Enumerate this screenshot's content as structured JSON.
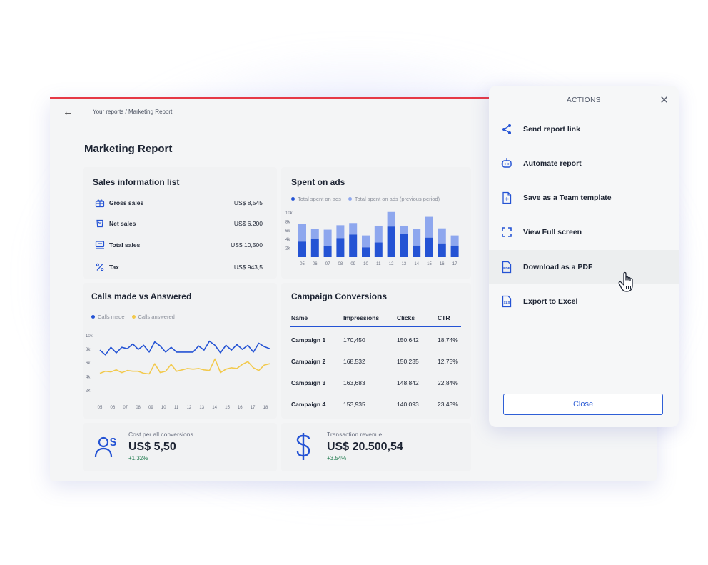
{
  "breadcrumb": "Your reports / Marketing Report",
  "page_title": "Marketing Report",
  "colors": {
    "primary": "#2453d4",
    "primary_light": "#8ea7ee",
    "yellow": "#f2c94c",
    "green": "#1f7a4d",
    "red_accent": "#e63946"
  },
  "sales": {
    "title": "Sales information list",
    "rows": [
      {
        "icon": "gift-icon",
        "label": "Gross sales",
        "value": "US$ 8,545"
      },
      {
        "icon": "cart-icon",
        "label": "Net sales",
        "value": "US$ 6,200"
      },
      {
        "icon": "register-icon",
        "label": "Total sales",
        "value": "US$ 10,500"
      },
      {
        "icon": "percent-icon",
        "label": "Tax",
        "value": "US$ 943,5"
      }
    ]
  },
  "spent": {
    "title": "Spent on ads",
    "legend": [
      "Total spent on ads",
      "Total spent on ads (previous period)"
    ]
  },
  "calls": {
    "title": "Calls made vs Answered",
    "legend": [
      "Calls made",
      "Calls answered"
    ]
  },
  "campaign": {
    "title": "Campaign Conversions",
    "headers": [
      "Name",
      "Impressions",
      "Clicks",
      "CTR"
    ],
    "rows": [
      [
        "Campaign 1",
        "170,450",
        "150,642",
        "18,74%"
      ],
      [
        "Campaign 2",
        "168,532",
        "150,235",
        "12,75%"
      ],
      [
        "Campaign 3",
        "163,683",
        "148,842",
        "22,84%"
      ],
      [
        "Campaign 4",
        "153,935",
        "140,093",
        "23,43%"
      ]
    ]
  },
  "kpis": [
    {
      "icon": "user-dollar-icon",
      "label": "Cost per all conversions",
      "value": "US$ 5,50",
      "delta": "+1.32%"
    },
    {
      "icon": "dollar-icon",
      "label": "Transaction revenue",
      "value": "US$ 20.500,54",
      "delta": "+3.54%"
    }
  ],
  "actions_panel": {
    "title": "ACTIONS",
    "items": [
      {
        "icon": "share-icon",
        "label": "Send report link"
      },
      {
        "icon": "robot-icon",
        "label": "Automate report"
      },
      {
        "icon": "file-plus-icon",
        "label": "Save as a Team template"
      },
      {
        "icon": "fullscreen-icon",
        "label": "View Full screen"
      },
      {
        "icon": "pdf-icon",
        "label": "Download as a PDF"
      },
      {
        "icon": "xls-icon",
        "label": "Export to Excel"
      }
    ],
    "close_label": "Close"
  },
  "chart_data": [
    {
      "type": "bar",
      "title": "Spent on ads",
      "categories": [
        "05",
        "06",
        "07",
        "08",
        "09",
        "10",
        "11",
        "12",
        "13",
        "14",
        "15",
        "16",
        "17"
      ],
      "ylim": [
        0,
        10000
      ],
      "yticks": [
        "2k",
        "4k",
        "6k",
        "8k",
        "10k"
      ],
      "stacked": true,
      "series": [
        {
          "name": "Total spent on ads",
          "values": [
            3500,
            4200,
            2500,
            4300,
            5100,
            2200,
            3300,
            6900,
            5200,
            2600,
            4400,
            3100,
            2600
          ]
        },
        {
          "name": "Total spent on ads (previous period)",
          "values": [
            4000,
            2100,
            3700,
            2900,
            2600,
            2700,
            3800,
            3300,
            1900,
            3800,
            4700,
            3400,
            2300
          ]
        }
      ],
      "grid": false,
      "legend": "top-left"
    },
    {
      "type": "line",
      "title": "Calls made vs Answered",
      "x": [
        "05",
        "06",
        "07",
        "08",
        "09",
        "10",
        "11",
        "12",
        "13",
        "14",
        "15",
        "16",
        "17",
        "18"
      ],
      "ylim": [
        1000,
        10000
      ],
      "yticks": [
        "2k",
        "4k",
        "6k",
        "8k",
        "10k"
      ],
      "series": [
        {
          "name": "Calls made",
          "values": [
            7900,
            7200,
            8300,
            7500,
            8300,
            8100,
            8800,
            8000,
            8600,
            7600,
            9100,
            8500,
            7600,
            8300,
            7600,
            7600,
            7600,
            7600,
            8500,
            7900,
            9200,
            8600,
            7500,
            8600,
            7900,
            8700,
            8000,
            8600,
            7600,
            8900,
            8400,
            8100
          ]
        },
        {
          "name": "Calls answered",
          "values": [
            4500,
            4800,
            4700,
            5000,
            4600,
            4900,
            4800,
            4800,
            4500,
            4400,
            5900,
            4600,
            4800,
            5800,
            4800,
            5000,
            5200,
            5100,
            5200,
            5000,
            4900,
            6600,
            4600,
            5100,
            5300,
            5200,
            5800,
            6200,
            5300,
            4900,
            5700,
            5900
          ]
        }
      ],
      "grid": false,
      "legend": "top-left"
    }
  ]
}
